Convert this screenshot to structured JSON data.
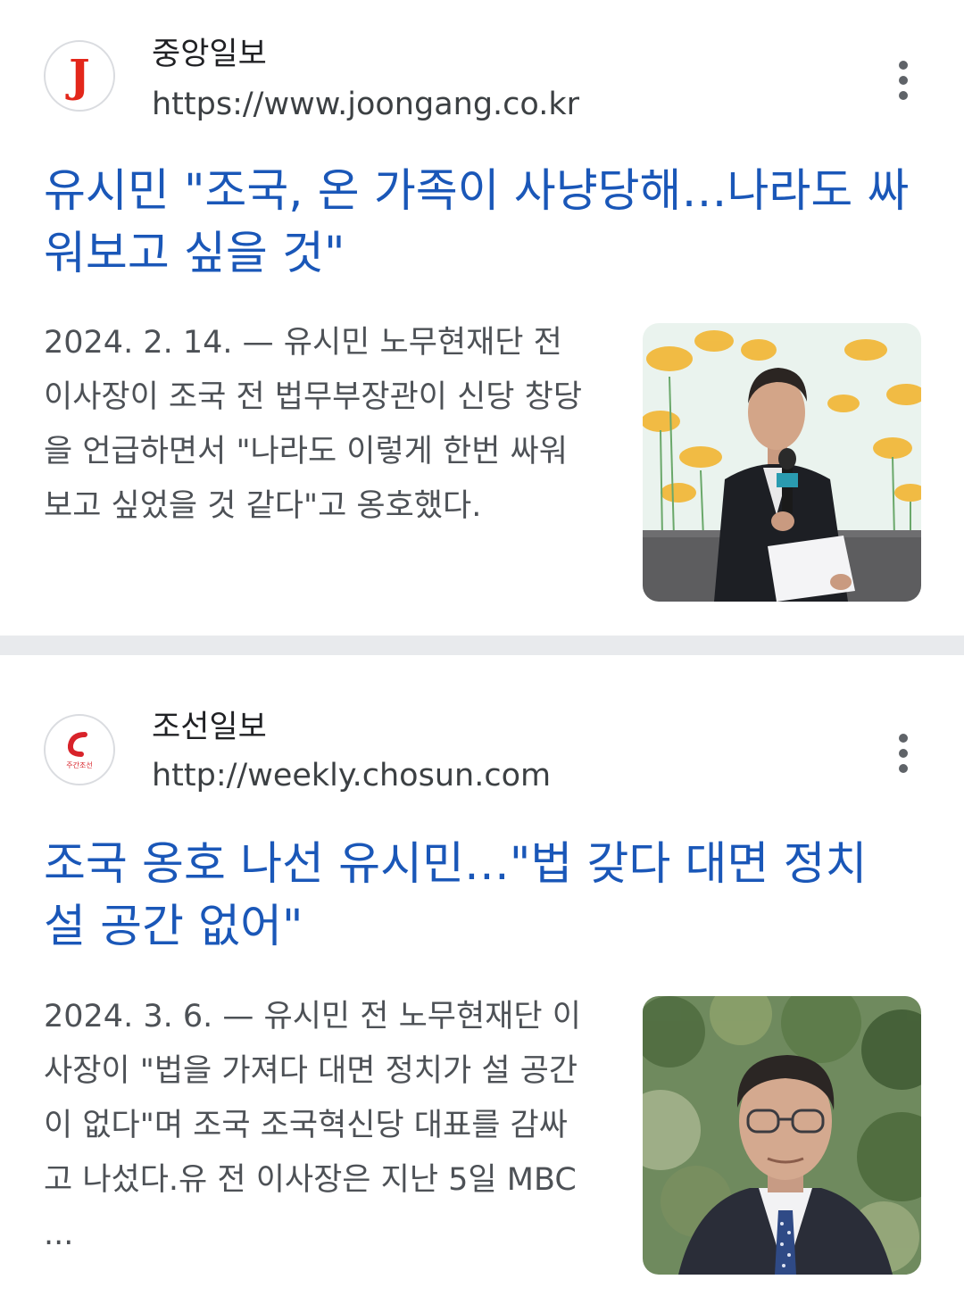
{
  "results": [
    {
      "source_name": "중앙일보",
      "source_url": "https://www.joongang.co.kr",
      "logo_letter": "J",
      "title": "유시민 \"조국, 온 가족이 사냥당해…나라도 싸워보고 싶을 것\"",
      "date": "2024. 2. 14.",
      "separator": " — ",
      "snippet": "유시민 노무현재단 전 이사장이 조국 전 법무부장관이 신당 창당을 언급하면서 \"나라도 이렇게 한번 싸워보고 싶었을 것 같다\"고 옹호했다.",
      "menu_icon": "more-vert-icon",
      "thumbnail_icon": "news-photo-speaker-microphone"
    },
    {
      "source_name": "조선일보",
      "source_url": "http://weekly.chosun.com",
      "logo_text": "주간조선",
      "title": "조국 옹호 나선 유시민…\"법 갖다 대면 정치 설 공간 없어\"",
      "date": "2024. 3. 6.",
      "separator": " — ",
      "snippet": "유시민 전 노무현재단 이사장이 \"법을 가져다 대면 정치가 설 공간이 없다\"며 조국 조국혁신당 대표를 감싸고 나섰다.유 전 이사장은 지난 5일 MBC ...",
      "menu_icon": "more-vert-icon",
      "thumbnail_icon": "news-photo-portrait"
    }
  ],
  "colors": {
    "title_link": "#1a57b8",
    "snippet_text": "#4d5156",
    "separator_band": "#e8eaed",
    "joongang_red": "#e3271b",
    "chosun_red": "#d8232a"
  }
}
